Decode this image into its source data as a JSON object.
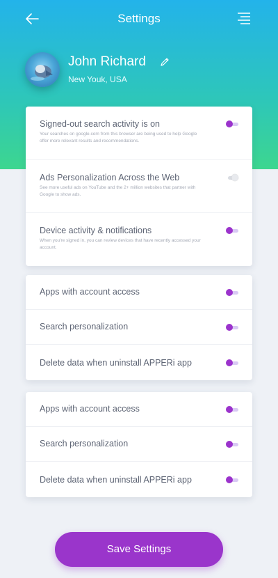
{
  "header": {
    "title": "Settings",
    "back_icon": "arrow-left-icon",
    "menu_icon": "menu-icon"
  },
  "profile": {
    "name": "John Richard",
    "location": "New Youk, USA",
    "edit_icon": "pencil-icon"
  },
  "colors": {
    "accent": "#9a35cb",
    "gradient_top": "#23b3ea",
    "gradient_bottom": "#3dd68f",
    "background": "#eef1f6"
  },
  "card1": {
    "items": [
      {
        "title": "Signed-out search activity is on",
        "desc": "Your searches on google.com from this browser are being used to help Google offer more relevant results and recommendations.",
        "on": true
      },
      {
        "title": "Ads Personalization Across the Web",
        "desc": "See more useful ads on YouTube and the 2+ million websites that partner with Google to show ads.",
        "on": false
      },
      {
        "title": "Device activity & notifications",
        "desc": "When you're signed in, you can review devices that have recently accessed your account.",
        "on": true
      }
    ]
  },
  "card2": {
    "items": [
      {
        "title": "Apps with account access",
        "on": true
      },
      {
        "title": "Search personalization",
        "on": true
      },
      {
        "title": "Delete data when uninstall APPERi app",
        "on": true
      }
    ]
  },
  "card3": {
    "items": [
      {
        "title": "Apps with account access",
        "on": true
      },
      {
        "title": "Search personalization",
        "on": true
      },
      {
        "title": "Delete data when uninstall APPERi app",
        "on": true
      }
    ]
  },
  "save_button": {
    "label": "Save Settings"
  }
}
